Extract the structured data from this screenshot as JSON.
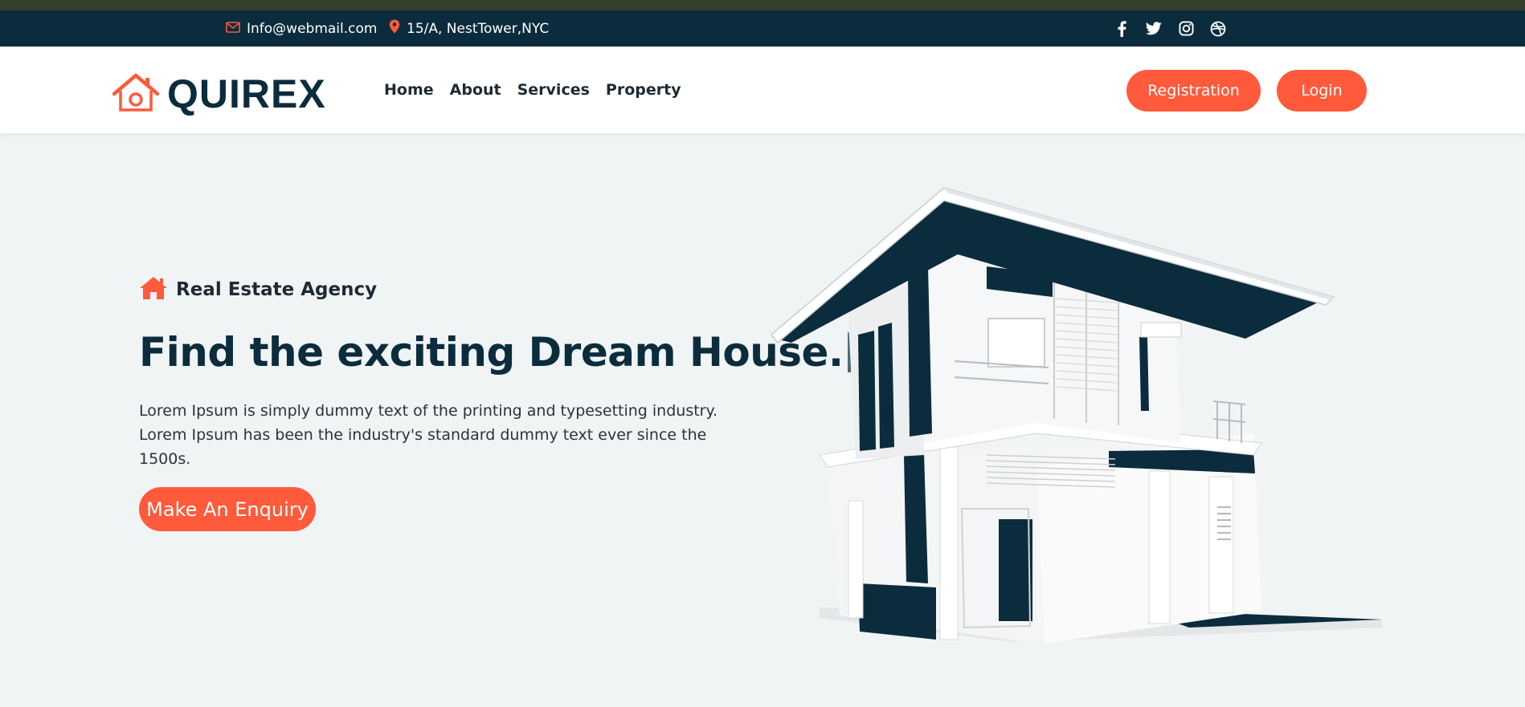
{
  "topbar": {
    "email": "Info@webmail.com",
    "address": "15/A, NestTower,NYC",
    "socials": [
      "facebook-icon",
      "twitter-icon",
      "instagram-icon",
      "dribbble-icon"
    ]
  },
  "nav": {
    "brand": "QUIREX",
    "links": [
      "Home",
      "About",
      "Services",
      "Property"
    ],
    "register_label": "Registration",
    "login_label": "Login"
  },
  "hero": {
    "tag": "Real Estate Agency",
    "title": "Find the exciting Dream House.",
    "description": "Lorem Ipsum is simply dummy text of the printing and typesetting industry. Lorem Ipsum has been the industry's standard dummy text ever since the 1500s.",
    "cta_label": "Make An Enquiry"
  },
  "colors": {
    "primary": "#0b2c3d",
    "accent": "#ff5a3c",
    "background": "#f1f4f5"
  }
}
